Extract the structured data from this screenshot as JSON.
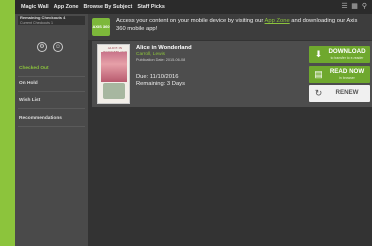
{
  "nav": {
    "items": [
      "Magic Wall",
      "App Zone",
      "Browse By Subject",
      "Staff Picks"
    ]
  },
  "sidebar": {
    "header_line1": "Remaining Checkouts 4",
    "header_line2": "Current Checkouts 1",
    "items": [
      "Checked Out",
      "On Hold",
      "Wish List",
      "Recommendations"
    ]
  },
  "banner": {
    "logo_text": "AXIS 360",
    "text_before": "Access your content on your mobile device by visiting our ",
    "link": "App Zone",
    "text_after": " and downloading our Axis 360 mobile app!"
  },
  "book": {
    "cover_title": "ALICE IN WONDERLAND",
    "title": "Alice in Wonderland",
    "author": "Carroll, Lewis",
    "publication": "Publication Date: 2015-06-08",
    "due": "Due: 11/10/2016",
    "remaining": "Remaining: 3 Days"
  },
  "actions": {
    "download_label": "DOWNLOAD",
    "download_sub": "to transfer to e-reader",
    "read_label": "READ NOW",
    "read_sub": "in browser",
    "renew_label": "RENEW"
  },
  "colors": {
    "accent": "#8cc43c",
    "button_green": "#6fa82e"
  }
}
